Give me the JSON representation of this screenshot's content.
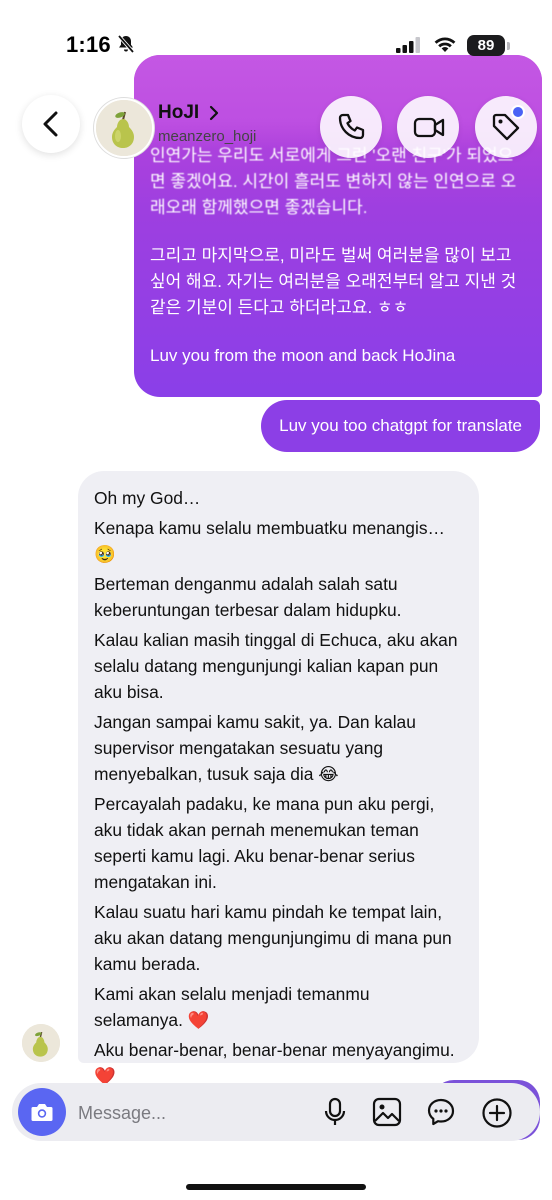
{
  "status_bar": {
    "time": "1:16",
    "battery": "89"
  },
  "header": {
    "name": "HoJI",
    "handle": "meanzero_hoji"
  },
  "messages": {
    "sent_long": {
      "p1": "인연가는 우리도 서로에게 그런 '오랜 친구'가 되었으면 좋겠어요. 시간이 흘러도 변하지 않는 인연으로 오래오래 함께했으면 좋겠습니다.",
      "p2": "그리고 마지막으로, 미라도 벌써 여러분을 많이 보고 싶어 해요. 자기는 여러분을 오래전부터 알고 지낸 것 같은 기분이 든다고 하더라고요. ㅎㅎ",
      "p3": "Luv you from the moon and back HoJina"
    },
    "sent_short": "Luv you too chatgpt for translate",
    "received": [
      "Oh my God…",
      "Kenapa kamu selalu membuatku menangis… 🥹",
      "Berteman denganmu adalah salah satu keberuntungan terbesar dalam hidupku.",
      "Kalau kalian masih tinggal di Echuca, aku akan selalu datang mengunjungi kalian kapan pun aku bisa.",
      "Jangan sampai kamu sakit, ya. Dan kalau supervisor mengatakan sesuatu yang menyebalkan, tusuk saja dia 😂",
      "Percayalah padaku, ke mana pun aku pergi, aku tidak akan pernah menemukan teman seperti kamu lagi. Aku benar-benar serius mengatakan ini.",
      "Kalau suatu hari kamu pindah ke tempat lain, aku akan datang mengunjungimu di mana pun kamu berada.",
      "Kami akan selalu menjadi temanmu selamanya. ❤️",
      "Aku benar-benar, benar-benar menyayangimu. ❤️"
    ]
  },
  "composer": {
    "placeholder": "Message..."
  },
  "icons": {
    "back": "chevron-left-icon",
    "call": "phone-icon",
    "video": "video-camera-icon",
    "tag": "tag-icon",
    "camera": "camera-icon",
    "mic": "microphone-icon",
    "gallery": "image-icon",
    "sticker": "chat-bubble-icon",
    "more": "plus-circle-icon"
  },
  "colors": {
    "accent": "#8c3fe6",
    "received_bg": "#efeff4",
    "camera_button": "#5a66f2"
  }
}
